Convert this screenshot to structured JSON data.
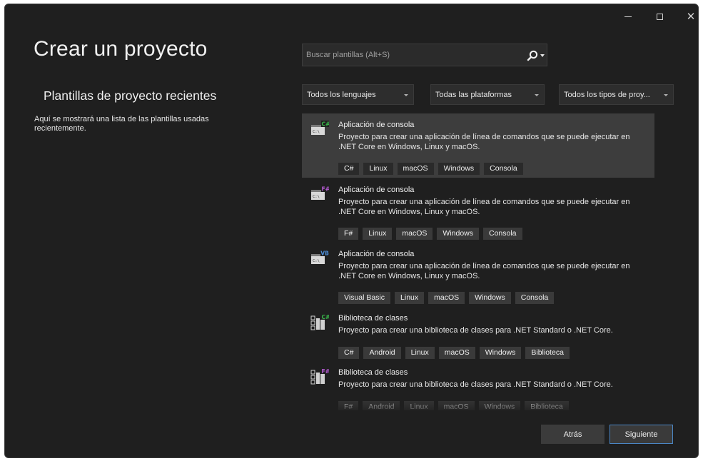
{
  "window_controls": [
    "minimize",
    "maximize",
    "close"
  ],
  "page_title": "Crear un proyecto",
  "recent": {
    "title": "Plantillas de proyecto recientes",
    "description": "Aquí se mostrará una lista de las plantillas usadas recientemente."
  },
  "search": {
    "placeholder": "Buscar plantillas (Alt+S)"
  },
  "filters": {
    "language": "Todos los lenguajes",
    "platform": "Todas las plataformas",
    "project_type": "Todos los tipos de proy..."
  },
  "templates": [
    {
      "title": "Aplicación de consola",
      "description": "Proyecto para crear una aplicación de línea de comandos que se puede ejecutar en .NET Core en Windows, Linux y macOS.",
      "badge": "C#",
      "tags": [
        "C#",
        "Linux",
        "macOS",
        "Windows",
        "Consola"
      ],
      "selected": true,
      "icon": "console-app-icon"
    },
    {
      "title": "Aplicación de consola",
      "description": "Proyecto para crear una aplicación de línea de comandos que se puede ejecutar en .NET Core en Windows, Linux y macOS.",
      "badge": "F#",
      "tags": [
        "F#",
        "Linux",
        "macOS",
        "Windows",
        "Consola"
      ],
      "selected": false,
      "icon": "console-app-icon"
    },
    {
      "title": "Aplicación de consola",
      "description": "Proyecto para crear una aplicación de línea de comandos que se puede ejecutar en .NET Core en Windows, Linux y macOS.",
      "badge": "VB",
      "tags": [
        "Visual Basic",
        "Linux",
        "macOS",
        "Windows",
        "Consola"
      ],
      "selected": false,
      "icon": "console-app-icon"
    },
    {
      "title": "Biblioteca de clases",
      "description": "Proyecto para crear una biblioteca de clases para .NET Standard o .NET Core.",
      "badge": "C#",
      "tags": [
        "C#",
        "Android",
        "Linux",
        "macOS",
        "Windows",
        "Biblioteca"
      ],
      "selected": false,
      "icon": "class-library-icon"
    },
    {
      "title": "Biblioteca de clases",
      "description": "Proyecto para crear una biblioteca de clases para .NET Standard o .NET Core.",
      "badge": "F#",
      "tags": [
        "F#",
        "Android",
        "Linux",
        "macOS",
        "Windows",
        "Biblioteca"
      ],
      "selected": false,
      "icon": "class-library-icon"
    }
  ],
  "buttons": {
    "back": "Atrás",
    "next": "Siguiente"
  },
  "colors": {
    "background": "#1f1f1f",
    "selected_row": "#3d3d3d",
    "tag": "#3a3a3a",
    "accent_border": "#4b86c4",
    "badge_csharp": "#39b54a",
    "badge_fsharp": "#b45ad2",
    "badge_vb": "#4c8ed9"
  }
}
